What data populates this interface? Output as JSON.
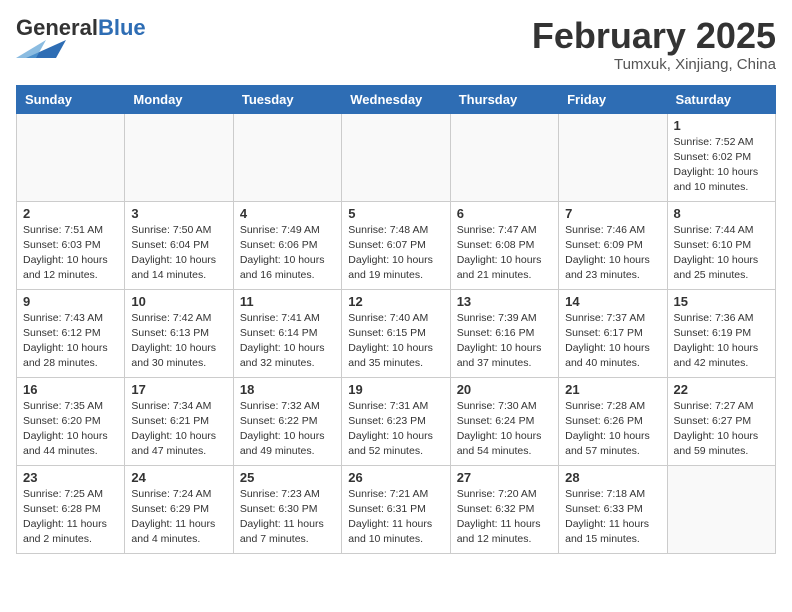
{
  "header": {
    "logo_general": "General",
    "logo_blue": "Blue",
    "month_title": "February 2025",
    "location": "Tumxuk, Xinjiang, China"
  },
  "weekdays": [
    "Sunday",
    "Monday",
    "Tuesday",
    "Wednesday",
    "Thursday",
    "Friday",
    "Saturday"
  ],
  "weeks": [
    [
      {
        "day": "",
        "info": ""
      },
      {
        "day": "",
        "info": ""
      },
      {
        "day": "",
        "info": ""
      },
      {
        "day": "",
        "info": ""
      },
      {
        "day": "",
        "info": ""
      },
      {
        "day": "",
        "info": ""
      },
      {
        "day": "1",
        "info": "Sunrise: 7:52 AM\nSunset: 6:02 PM\nDaylight: 10 hours\nand 10 minutes."
      }
    ],
    [
      {
        "day": "2",
        "info": "Sunrise: 7:51 AM\nSunset: 6:03 PM\nDaylight: 10 hours\nand 12 minutes."
      },
      {
        "day": "3",
        "info": "Sunrise: 7:50 AM\nSunset: 6:04 PM\nDaylight: 10 hours\nand 14 minutes."
      },
      {
        "day": "4",
        "info": "Sunrise: 7:49 AM\nSunset: 6:06 PM\nDaylight: 10 hours\nand 16 minutes."
      },
      {
        "day": "5",
        "info": "Sunrise: 7:48 AM\nSunset: 6:07 PM\nDaylight: 10 hours\nand 19 minutes."
      },
      {
        "day": "6",
        "info": "Sunrise: 7:47 AM\nSunset: 6:08 PM\nDaylight: 10 hours\nand 21 minutes."
      },
      {
        "day": "7",
        "info": "Sunrise: 7:46 AM\nSunset: 6:09 PM\nDaylight: 10 hours\nand 23 minutes."
      },
      {
        "day": "8",
        "info": "Sunrise: 7:44 AM\nSunset: 6:10 PM\nDaylight: 10 hours\nand 25 minutes."
      }
    ],
    [
      {
        "day": "9",
        "info": "Sunrise: 7:43 AM\nSunset: 6:12 PM\nDaylight: 10 hours\nand 28 minutes."
      },
      {
        "day": "10",
        "info": "Sunrise: 7:42 AM\nSunset: 6:13 PM\nDaylight: 10 hours\nand 30 minutes."
      },
      {
        "day": "11",
        "info": "Sunrise: 7:41 AM\nSunset: 6:14 PM\nDaylight: 10 hours\nand 32 minutes."
      },
      {
        "day": "12",
        "info": "Sunrise: 7:40 AM\nSunset: 6:15 PM\nDaylight: 10 hours\nand 35 minutes."
      },
      {
        "day": "13",
        "info": "Sunrise: 7:39 AM\nSunset: 6:16 PM\nDaylight: 10 hours\nand 37 minutes."
      },
      {
        "day": "14",
        "info": "Sunrise: 7:37 AM\nSunset: 6:17 PM\nDaylight: 10 hours\nand 40 minutes."
      },
      {
        "day": "15",
        "info": "Sunrise: 7:36 AM\nSunset: 6:19 PM\nDaylight: 10 hours\nand 42 minutes."
      }
    ],
    [
      {
        "day": "16",
        "info": "Sunrise: 7:35 AM\nSunset: 6:20 PM\nDaylight: 10 hours\nand 44 minutes."
      },
      {
        "day": "17",
        "info": "Sunrise: 7:34 AM\nSunset: 6:21 PM\nDaylight: 10 hours\nand 47 minutes."
      },
      {
        "day": "18",
        "info": "Sunrise: 7:32 AM\nSunset: 6:22 PM\nDaylight: 10 hours\nand 49 minutes."
      },
      {
        "day": "19",
        "info": "Sunrise: 7:31 AM\nSunset: 6:23 PM\nDaylight: 10 hours\nand 52 minutes."
      },
      {
        "day": "20",
        "info": "Sunrise: 7:30 AM\nSunset: 6:24 PM\nDaylight: 10 hours\nand 54 minutes."
      },
      {
        "day": "21",
        "info": "Sunrise: 7:28 AM\nSunset: 6:26 PM\nDaylight: 10 hours\nand 57 minutes."
      },
      {
        "day": "22",
        "info": "Sunrise: 7:27 AM\nSunset: 6:27 PM\nDaylight: 10 hours\nand 59 minutes."
      }
    ],
    [
      {
        "day": "23",
        "info": "Sunrise: 7:25 AM\nSunset: 6:28 PM\nDaylight: 11 hours\nand 2 minutes."
      },
      {
        "day": "24",
        "info": "Sunrise: 7:24 AM\nSunset: 6:29 PM\nDaylight: 11 hours\nand 4 minutes."
      },
      {
        "day": "25",
        "info": "Sunrise: 7:23 AM\nSunset: 6:30 PM\nDaylight: 11 hours\nand 7 minutes."
      },
      {
        "day": "26",
        "info": "Sunrise: 7:21 AM\nSunset: 6:31 PM\nDaylight: 11 hours\nand 10 minutes."
      },
      {
        "day": "27",
        "info": "Sunrise: 7:20 AM\nSunset: 6:32 PM\nDaylight: 11 hours\nand 12 minutes."
      },
      {
        "day": "28",
        "info": "Sunrise: 7:18 AM\nSunset: 6:33 PM\nDaylight: 11 hours\nand 15 minutes."
      },
      {
        "day": "",
        "info": ""
      }
    ]
  ]
}
